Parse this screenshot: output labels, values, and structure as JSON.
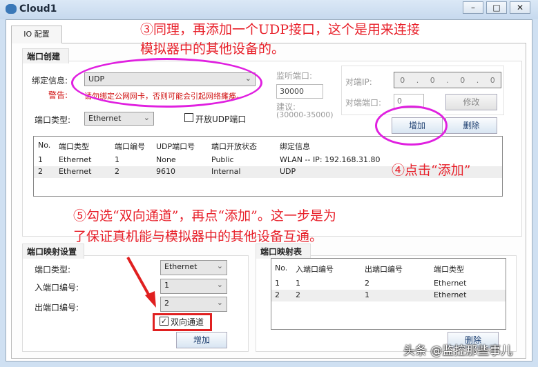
{
  "window": {
    "title": "Cloud1",
    "buttons": [
      "–",
      "□",
      "✕"
    ]
  },
  "tab": "IO 配置",
  "creation": {
    "heading": "端口创建",
    "bind_label": "绑定信息:",
    "bind_value": "UDP",
    "warn_label": "警告:",
    "warn_text": "请勿绑定公网网卡，否则可能会引起网络瘫痪。",
    "type_label": "端口类型:",
    "type_value": "Ethernet",
    "open_udp_label": "开放UDP端口",
    "listen_label": "监听端口:",
    "listen_value": "30000",
    "suggest_label": "建议:",
    "suggest_range": "(30000-35000)",
    "peer_ip_label": "对端IP:",
    "peer_ip": [
      "0",
      "0",
      "0",
      "0"
    ],
    "peer_port_label": "对端端口:",
    "peer_port": "0",
    "modify": "修改",
    "add": "增加",
    "delete": "删除",
    "columns": [
      "No.",
      "端口类型",
      "端口编号",
      "UDP端口号",
      "端口开放状态",
      "绑定信息"
    ],
    "rows": [
      [
        "1",
        "Ethernet",
        "1",
        "None",
        "Public",
        "WLAN -- IP: 192.168.31.80"
      ],
      [
        "2",
        "Ethernet",
        "2",
        "9610",
        "Internal",
        "UDP"
      ]
    ]
  },
  "mapping": {
    "heading": "端口映射设置",
    "type_label": "端口类型:",
    "type_value": "Ethernet",
    "in_label": "入端口编号:",
    "in_value": "1",
    "out_label": "出端口编号:",
    "out_value": "2",
    "bidir_label": "双向通道",
    "bidir_checked": true,
    "add": "增加"
  },
  "map_table": {
    "heading": "端口映射表",
    "columns": [
      "No.",
      "入端口编号",
      "出端口编号",
      "端口类型"
    ],
    "rows": [
      [
        "1",
        "1",
        "2",
        "Ethernet"
      ],
      [
        "2",
        "2",
        "1",
        "Ethernet"
      ]
    ],
    "delete": "删除"
  },
  "annotations": {
    "a3_line1": "③同理，再添加一个UDP接口，这个是用来连接",
    "a3_line2": "模拟器中的其他设备的。",
    "a4": "④点击“添加”",
    "a5_line1": "⑤勾选“双向通道”，再点“添加”。这一步是为",
    "a5_line2": "了保证真机能与模拟器中的其他设备互通。"
  },
  "watermark": "头条 @监控那些事儿"
}
